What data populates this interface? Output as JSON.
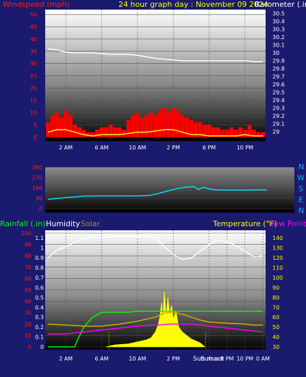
{
  "header": {
    "wind_title": "Windspeed (mph)",
    "graph_title": "24 hour graph day : November 09 2024",
    "baro_title": "Barometer (.in)"
  },
  "panel2": {
    "dir_labels": [
      "N",
      "W",
      "S",
      "E",
      "N"
    ]
  },
  "panel3": {
    "rain_title": "Rainfall (.in)",
    "humidity_title": "Humidity",
    "solar_title": "Solar",
    "temp_title": "Temperature (°F)",
    "dew_title": "Dew Point (",
    "sunrise_label": "Sun rise",
    "sunset_label": "Sun set"
  },
  "colors": {
    "background": "#1a1a6e",
    "wind": "#ff0000",
    "gust": "#ffff00",
    "barometer": "#ffffff",
    "direction": "#00e5ff",
    "humidity": "#ffffff",
    "temperature": "#ffff00",
    "dewpoint": "#ff00ff",
    "solar": "#ffff00",
    "rainfall": "#00ff00"
  },
  "chart_data": [
    {
      "type": "line",
      "title": "24 hour graph day : November 09 2024",
      "x_ticks": [
        "2 AM",
        "6 AM",
        "10 AM",
        "2 PM",
        "6 PM",
        "10 PM"
      ],
      "left_axis": {
        "label": "Windspeed (mph)",
        "ticks": [
          "0",
          "5",
          "10",
          "15",
          "20",
          "25",
          "30",
          "35",
          "40",
          "45",
          "50"
        ],
        "range": [
          0,
          52
        ]
      },
      "right_axis": {
        "label": "Barometer (.in)",
        "ticks": [
          "29",
          "29.1",
          "29.2",
          "29.3",
          "29.4",
          "29.5",
          "29.6",
          "29.7",
          "29.8",
          "29.9",
          "30",
          "30.1",
          "30.2",
          "30.3",
          "30.4",
          "30.5"
        ],
        "range": [
          28.93,
          30.55
        ]
      },
      "x_range": [
        0,
        24
      ],
      "grid": true,
      "series": [
        {
          "name": "Barometer (.in)",
          "axis": "right",
          "points": [
            [
              0,
              30.05
            ],
            [
              1,
              30.04
            ],
            [
              2,
              30.01
            ],
            [
              3,
              30.0
            ],
            [
              4,
              30.0
            ],
            [
              5,
              30.0
            ],
            [
              6,
              29.99
            ],
            [
              7,
              29.98
            ],
            [
              8,
              29.98
            ],
            [
              9,
              29.98
            ],
            [
              10,
              29.97
            ],
            [
              11,
              29.95
            ],
            [
              12,
              29.93
            ],
            [
              13,
              29.92
            ],
            [
              14,
              29.91
            ],
            [
              15,
              29.9
            ],
            [
              16,
              29.9
            ],
            [
              17,
              29.9
            ],
            [
              18,
              29.9
            ],
            [
              19,
              29.9
            ],
            [
              20,
              29.9
            ],
            [
              21,
              29.9
            ],
            [
              22,
              29.9
            ],
            [
              23,
              29.89
            ],
            [
              24,
              29.89
            ]
          ]
        },
        {
          "name": "Windspeed (mph)",
          "axis": "left",
          "kind": "bars",
          "points": [
            [
              0,
              6
            ],
            [
              0.5,
              9
            ],
            [
              1,
              10
            ],
            [
              1.5,
              8
            ],
            [
              2,
              11
            ],
            [
              2.5,
              9
            ],
            [
              3,
              5
            ],
            [
              3.5,
              4
            ],
            [
              4,
              3
            ],
            [
              4.5,
              2
            ],
            [
              5,
              2
            ],
            [
              5.5,
              3
            ],
            [
              6,
              4
            ],
            [
              6.5,
              4
            ],
            [
              7,
              5
            ],
            [
              7.5,
              4
            ],
            [
              8,
              4
            ],
            [
              8.5,
              3
            ],
            [
              9,
              7
            ],
            [
              9.5,
              9
            ],
            [
              10,
              10
            ],
            [
              10.5,
              8
            ],
            [
              11,
              9
            ],
            [
              11.5,
              10
            ],
            [
              12,
              9
            ],
            [
              12.5,
              11
            ],
            [
              13,
              12
            ],
            [
              13.5,
              10
            ],
            [
              14,
              12
            ],
            [
              14.5,
              11
            ],
            [
              15,
              9
            ],
            [
              15.5,
              8
            ],
            [
              16,
              7
            ],
            [
              16.5,
              6
            ],
            [
              17,
              6
            ],
            [
              17.5,
              5
            ],
            [
              18,
              5
            ],
            [
              18.5,
              4
            ],
            [
              19,
              4
            ],
            [
              19.5,
              3
            ],
            [
              20,
              3
            ],
            [
              20.5,
              4
            ],
            [
              21,
              3
            ],
            [
              21.5,
              4
            ],
            [
              22,
              3
            ],
            [
              22.5,
              5
            ],
            [
              23,
              3
            ],
            [
              23.5,
              2
            ],
            [
              24,
              2
            ]
          ]
        },
        {
          "name": "Gust",
          "axis": "left",
          "points": [
            [
              0,
              2
            ],
            [
              1,
              3
            ],
            [
              2,
              3
            ],
            [
              3,
              2
            ],
            [
              4,
              1
            ],
            [
              5,
              0.5
            ],
            [
              6,
              1
            ],
            [
              7,
              1
            ],
            [
              8,
              1
            ],
            [
              9,
              1.5
            ],
            [
              10,
              2
            ],
            [
              11,
              2
            ],
            [
              12,
              2.5
            ],
            [
              13,
              3
            ],
            [
              14,
              3
            ],
            [
              15,
              2
            ],
            [
              16,
              1
            ],
            [
              17,
              1
            ],
            [
              18,
              0.5
            ],
            [
              19,
              0.5
            ],
            [
              20,
              0.5
            ],
            [
              21,
              0.5
            ],
            [
              22,
              1
            ],
            [
              23,
              0.5
            ],
            [
              24,
              0.5
            ]
          ]
        }
      ]
    },
    {
      "type": "line",
      "x_range": [
        0,
        24
      ],
      "left_axis": {
        "label": "",
        "ticks": [
          "0",
          "90",
          "180",
          "270",
          "360"
        ],
        "range": [
          0,
          360
        ]
      },
      "right_axis": {
        "label": "",
        "ticks": [
          "N",
          "E",
          "S",
          "W",
          "N"
        ]
      },
      "grid": true,
      "series": [
        {
          "name": "Wind direction",
          "points": [
            [
              0,
              80
            ],
            [
              2,
              95
            ],
            [
              3,
              100
            ],
            [
              4,
              108
            ],
            [
              6,
              110
            ],
            [
              8,
              110
            ],
            [
              10,
              110
            ],
            [
              11,
              112
            ],
            [
              12,
              128
            ],
            [
              13,
              150
            ],
            [
              14,
              170
            ],
            [
              15,
              185
            ],
            [
              16,
              190
            ],
            [
              16.5,
              165
            ],
            [
              17,
              185
            ],
            [
              18,
              165
            ],
            [
              19,
              160
            ],
            [
              20,
              160
            ],
            [
              21,
              160
            ],
            [
              22,
              160
            ],
            [
              23,
              162
            ],
            [
              24,
              162
            ]
          ]
        }
      ]
    },
    {
      "type": "line",
      "x_ticks": [
        "2 AM",
        "6 AM",
        "10 AM",
        "2 PM",
        "6 PM",
        "8 PM",
        "10 PM",
        "0 AM"
      ],
      "left_axis_outer": {
        "label": "Humidity",
        "ticks": [
          "0",
          "10",
          "20",
          "30",
          "40",
          "50",
          "60",
          "70",
          "80",
          "90",
          "100"
        ],
        "range": [
          0,
          100
        ]
      },
      "left_axis_inner": {
        "label": "Rainfall (.in)",
        "ticks": [
          "0",
          "0.1",
          "0.2",
          "0.3",
          "0.4",
          "0.5",
          "0.6",
          "0.7",
          "0.8",
          "0.9",
          "1",
          "1.1"
        ],
        "range": [
          0,
          1.15
        ]
      },
      "right_axis": {
        "label": "Temperature (°F)",
        "ticks": [
          "30",
          "40",
          "50",
          "60",
          "70",
          "80",
          "90",
          "100",
          "110",
          "120",
          "130",
          "140"
        ],
        "range": [
          30,
          145
        ]
      },
      "x_range": [
        0,
        24
      ],
      "grid": true,
      "annotations": [
        "Sun rise",
        "Sun set"
      ],
      "series": [
        {
          "name": "Humidity",
          "axis": "outer",
          "points": [
            [
              0,
              78
            ],
            [
              0.5,
              82
            ],
            [
              1,
              85
            ],
            [
              2,
              88
            ],
            [
              3,
              92
            ],
            [
              4,
              95
            ],
            [
              5,
              96
            ],
            [
              6,
              96
            ],
            [
              7,
              97
            ],
            [
              8,
              97
            ],
            [
              9,
              97
            ],
            [
              10,
              97
            ],
            [
              11,
              97
            ],
            [
              12,
              96
            ],
            [
              13,
              88
            ],
            [
              14,
              81
            ],
            [
              15,
              77
            ],
            [
              16,
              78
            ],
            [
              17,
              84
            ],
            [
              18,
              90
            ],
            [
              19,
              94
            ],
            [
              20,
              92
            ],
            [
              21,
              89
            ],
            [
              22,
              84
            ],
            [
              23,
              79
            ],
            [
              24,
              80
            ]
          ]
        },
        {
          "name": "Temperature (°F)",
          "axis": "right",
          "points": [
            [
              0,
              53
            ],
            [
              2,
              52
            ],
            [
              4,
              51
            ],
            [
              6,
              51
            ],
            [
              8,
              53
            ],
            [
              10,
              56
            ],
            [
              12,
              60
            ],
            [
              13,
              64
            ],
            [
              14,
              65
            ],
            [
              15,
              63
            ],
            [
              16,
              60
            ],
            [
              17,
              57
            ],
            [
              18,
              55
            ],
            [
              20,
              54
            ],
            [
              22,
              53
            ],
            [
              23,
              52
            ],
            [
              24,
              52
            ]
          ]
        },
        {
          "name": "Dew Point",
          "axis": "right",
          "points": [
            [
              0,
              43
            ],
            [
              2,
              43
            ],
            [
              4,
              45
            ],
            [
              6,
              47
            ],
            [
              8,
              49
            ],
            [
              10,
              51
            ],
            [
              12,
              52
            ],
            [
              14,
              53
            ],
            [
              16,
              53
            ],
            [
              18,
              51
            ],
            [
              20,
              49
            ],
            [
              22,
              47
            ],
            [
              24,
              45
            ]
          ]
        },
        {
          "name": "Rainfall (.in)",
          "axis": "inner",
          "points": [
            [
              0,
              0
            ],
            [
              3,
              0
            ],
            [
              3.2,
              0.05
            ],
            [
              4,
              0.2
            ],
            [
              5,
              0.3
            ],
            [
              6,
              0.35
            ],
            [
              7,
              0.35
            ],
            [
              8,
              0.35
            ],
            [
              9,
              0.35
            ],
            [
              10,
              0.36
            ],
            [
              11,
              0.36
            ],
            [
              12,
              0.36
            ],
            [
              13,
              0.36
            ],
            [
              14,
              0.36
            ],
            [
              15,
              0.36
            ],
            [
              16,
              0.36
            ],
            [
              17,
              0.36
            ],
            [
              18,
              0.36
            ],
            [
              19,
              0.36
            ],
            [
              20,
              0.36
            ],
            [
              21,
              0.36
            ],
            [
              22,
              0.36
            ],
            [
              24,
              0.36
            ]
          ]
        },
        {
          "name": "Solar",
          "axis": "right",
          "kind": "area",
          "points": [
            [
              6.5,
              30
            ],
            [
              7.5,
              32
            ],
            [
              9,
              33
            ],
            [
              10,
              35
            ],
            [
              11,
              37
            ],
            [
              11.5,
              39
            ],
            [
              12,
              45
            ],
            [
              12.3,
              52
            ],
            [
              12.5,
              60
            ],
            [
              12.7,
              75
            ],
            [
              12.8,
              55
            ],
            [
              13,
              86
            ],
            [
              13.2,
              60
            ],
            [
              13.4,
              80
            ],
            [
              13.6,
              62
            ],
            [
              13.8,
              72
            ],
            [
              14,
              58
            ],
            [
              14.3,
              66
            ],
            [
              14.6,
              50
            ],
            [
              15,
              45
            ],
            [
              16,
              38
            ],
            [
              17,
              34
            ],
            [
              17.5,
              30
            ]
          ]
        }
      ]
    }
  ]
}
